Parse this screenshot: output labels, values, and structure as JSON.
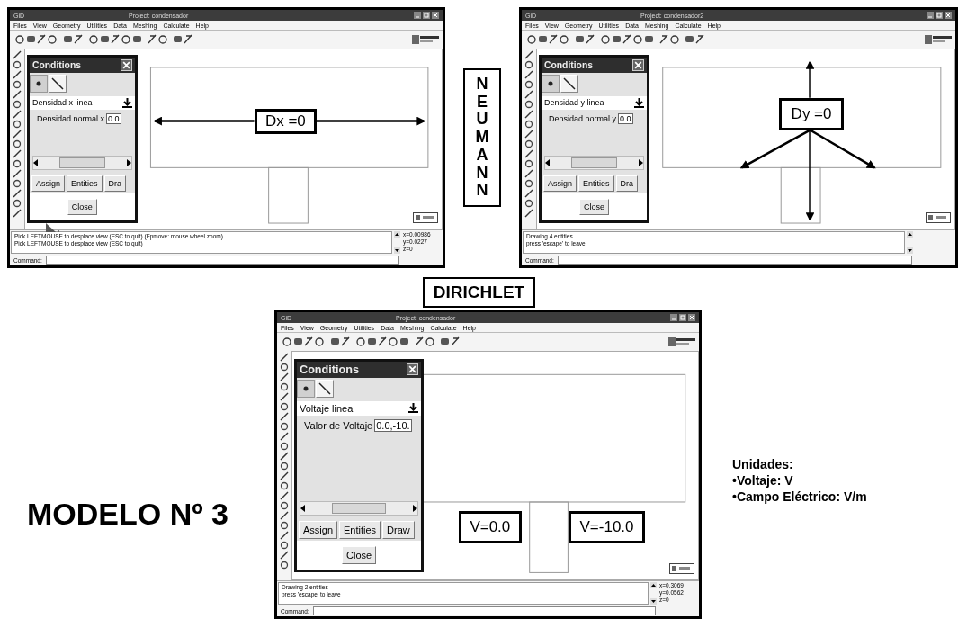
{
  "slide": {
    "neumann_label": "NEUMANN",
    "dirichlet_label": "DIRICHLET",
    "title": "MODELO Nº 3",
    "units_note": [
      "Unidades:",
      "•Voltaje: V",
      "•Campo Eléctrico: V/m"
    ]
  },
  "screens": [
    {
      "app_name": "GiD",
      "title": "Project: condensador",
      "menu": [
        "Files",
        "View",
        "Geometry",
        "Utilities",
        "Data",
        "Meshing",
        "Calculate",
        "Help"
      ],
      "dialog": {
        "title": "Conditions",
        "tabs": [
          {
            "kind": "point",
            "selected": false
          },
          {
            "kind": "line",
            "selected": true
          }
        ],
        "condition": "Densidad x linea",
        "field_label": "Densidad normal x",
        "field_value": "0.0",
        "buttons": [
          "Assign",
          "Entities",
          "Dra"
        ],
        "close": "Close"
      },
      "annotation": {
        "kind": "horizontal-arrows",
        "labels": [
          "Dx =0"
        ]
      },
      "cursor": true,
      "messages": [
        "Pick LEFTMOUSE to desplace view (ESC to quit) (Fpmove: mouse wheel zoom)",
        "Pick LEFTMOUSE to desplace view (ESC to quit)"
      ],
      "coords": [
        "x=0.00986",
        "y=0.0227",
        "z=0"
      ],
      "command_label": "Command:"
    },
    {
      "app_name": "GiD",
      "title": "Project: condensador2",
      "menu": [
        "Files",
        "View",
        "Geometry",
        "Utilities",
        "Data",
        "Meshing",
        "Calculate",
        "Help"
      ],
      "dialog": {
        "title": "Conditions",
        "tabs": [
          {
            "kind": "point",
            "selected": false
          },
          {
            "kind": "line",
            "selected": true
          }
        ],
        "condition": "Densidad y linea",
        "field_label": "Densidad normal y",
        "field_value": "0.0",
        "buttons": [
          "Assign",
          "Entities",
          "Dra"
        ],
        "close": "Close"
      },
      "annotation": {
        "kind": "spread-arrows",
        "labels": [
          "Dy =0"
        ]
      },
      "cursor": false,
      "messages": [
        "Drawing 4 entities",
        "press 'escape' to leave"
      ],
      "command_label": "Command:"
    },
    {
      "app_name": "GiD",
      "title": "Project: condensador",
      "menu": [
        "Files",
        "View",
        "Geometry",
        "Utilities",
        "Data",
        "Meshing",
        "Calculate",
        "Help"
      ],
      "dialog": {
        "title": "Conditions",
        "tabs": [
          {
            "kind": "point",
            "selected": false
          },
          {
            "kind": "line",
            "selected": true
          }
        ],
        "condition": "Voltaje linea",
        "field_label": "Valor de Voltaje",
        "field_value": "0.0,-10.",
        "buttons": [
          "Assign",
          "Entities",
          "Draw"
        ],
        "close": "Close"
      },
      "annotation": {
        "kind": "side-labels",
        "labels": [
          "V=0.0",
          "V=-10.0"
        ]
      },
      "cursor": false,
      "messages": [
        "Drawing 2 entities",
        "press 'escape' to leave"
      ],
      "coords": [
        "x=0.3069",
        "y=0.0562",
        "z=0"
      ],
      "command_label": "Command:"
    }
  ]
}
